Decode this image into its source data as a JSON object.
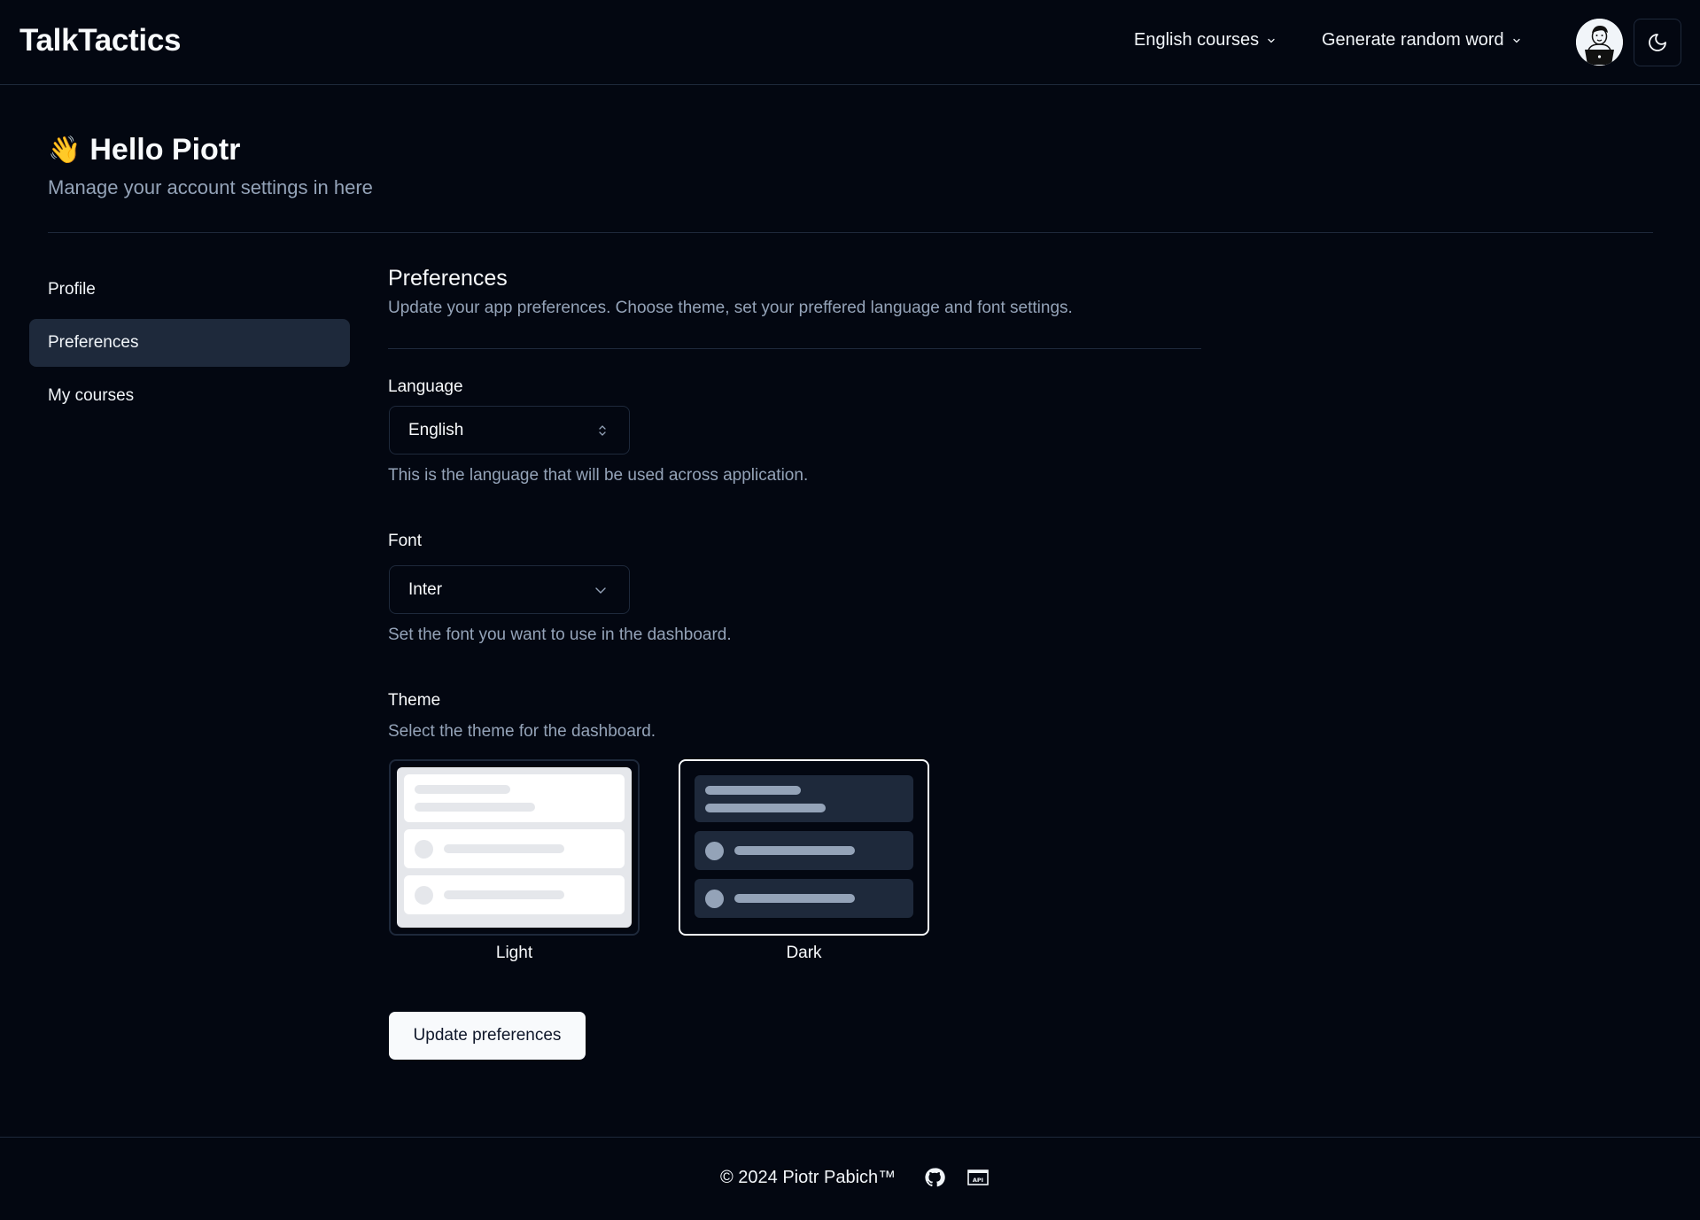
{
  "header": {
    "brand": "TalkTactics",
    "nav": [
      {
        "label": "English courses",
        "icon": "chevron-down-icon"
      },
      {
        "label": "Generate random word",
        "icon": "chevron-down-icon"
      }
    ],
    "avatar_icon": "user-avatar",
    "theme_toggle_icon": "moon-icon"
  },
  "greeting": {
    "emoji": "👋",
    "title": "Hello Piotr",
    "subtitle": "Manage your account settings in here"
  },
  "sidebar": {
    "items": [
      {
        "label": "Profile",
        "active": false
      },
      {
        "label": "Preferences",
        "active": true
      },
      {
        "label": "My courses",
        "active": false
      }
    ]
  },
  "preferences": {
    "title": "Preferences",
    "description": "Update your app preferences. Choose theme, set your preffered language and font settings.",
    "language": {
      "label": "Language",
      "value": "English",
      "help": "This is the language that will be used across application."
    },
    "font": {
      "label": "Font",
      "value": "Inter",
      "help": "Set the font you want to use in the dashboard."
    },
    "theme": {
      "label": "Theme",
      "description": "Select the theme for the dashboard.",
      "options": [
        {
          "label": "Light",
          "selected": false
        },
        {
          "label": "Dark",
          "selected": true
        }
      ]
    },
    "submit_label": "Update preferences"
  },
  "footer": {
    "copyright": "© 2024 Piotr Pabich™",
    "icons": [
      "github-icon",
      "api-icon"
    ]
  }
}
